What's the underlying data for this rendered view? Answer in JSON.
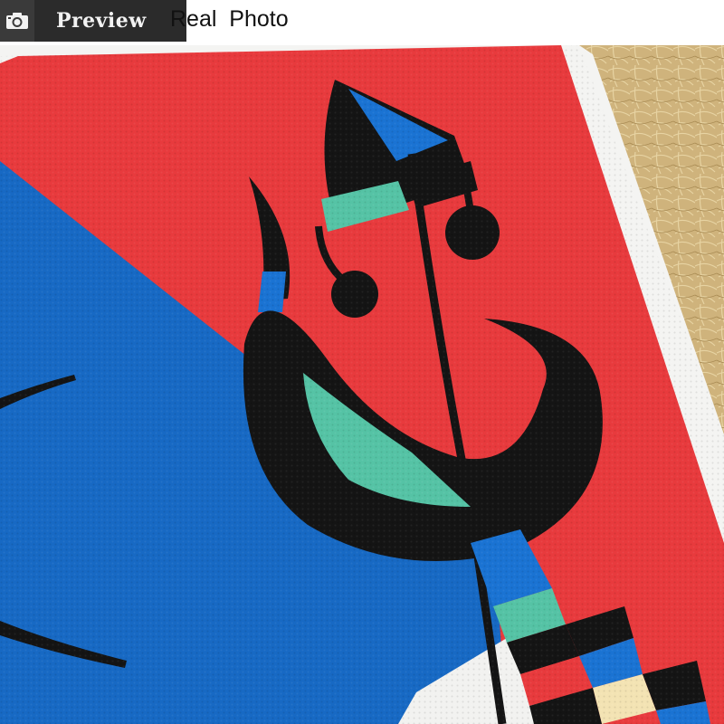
{
  "header": {
    "preview_label": "Preview",
    "photo_label": "Real  Photo",
    "icon": "camera-icon"
  },
  "colors": {
    "canvas_red": "#e83a3d",
    "canvas_blue": "#1769c4",
    "ink_black": "#141414",
    "teal": "#55c3a5",
    "cream": "#f3e3b3",
    "background_gold": "#cfb37c",
    "badge_dark": "#2b2b2b"
  }
}
